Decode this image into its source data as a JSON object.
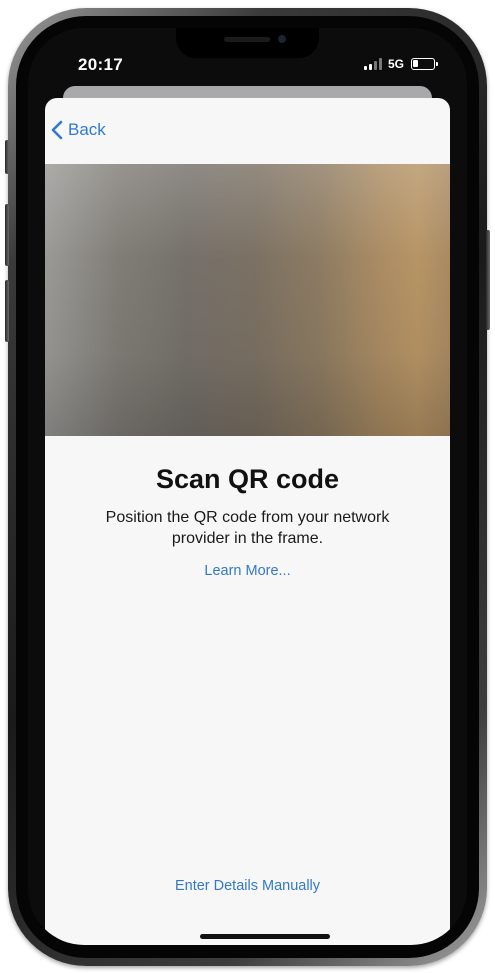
{
  "status_bar": {
    "time": "20:17",
    "network": "5G",
    "signal_icon": "signal-bars-icon",
    "battery_icon": "battery-icon",
    "battery_level": 0.25
  },
  "nav": {
    "back_label": "Back",
    "back_icon": "chevron-left-icon"
  },
  "content": {
    "title": "Scan QR code",
    "subtitle": "Position the QR code from your network provider in the frame.",
    "learn_more": "Learn More...",
    "enter_manually": "Enter Details Manually"
  },
  "colors": {
    "accent": "#2f7ad3",
    "sheet_background": "#f7f7f7",
    "text_primary": "#111111"
  }
}
